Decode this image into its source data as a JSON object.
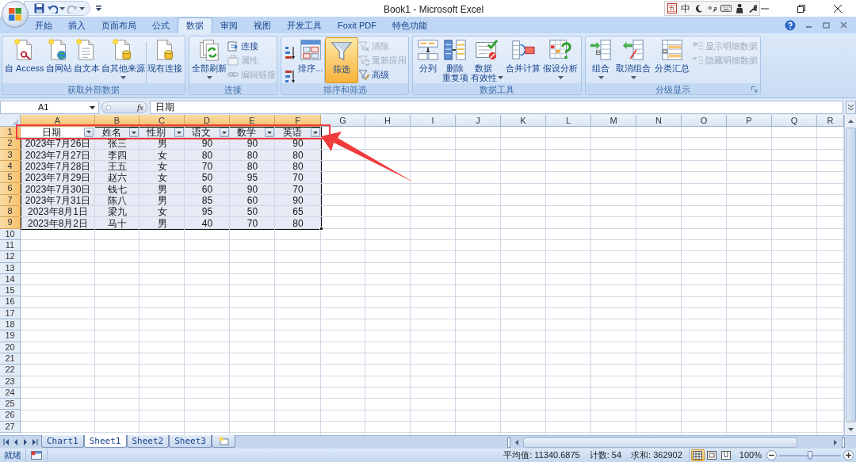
{
  "window": {
    "title": "Book1 - Microsoft Excel"
  },
  "ime_toolbar": {
    "items": [
      "五",
      "中"
    ]
  },
  "ribbon": {
    "tabs": [
      {
        "label": "开始",
        "selected": false
      },
      {
        "label": "插入",
        "selected": false
      },
      {
        "label": "页面布局",
        "selected": false
      },
      {
        "label": "公式",
        "selected": false
      },
      {
        "label": "数据",
        "selected": true
      },
      {
        "label": "审阅",
        "selected": false
      },
      {
        "label": "视图",
        "selected": false
      },
      {
        "label": "开发工具",
        "selected": false
      },
      {
        "label": "Foxit PDF",
        "selected": false
      },
      {
        "label": "特色功能",
        "selected": false
      }
    ],
    "groups": [
      {
        "label": "获取外部数据",
        "launcher": false,
        "items": [
          {
            "kind": "large",
            "label": "自 Access",
            "dropdown": false,
            "on": false
          },
          {
            "kind": "large",
            "label": "自网站",
            "dropdown": false,
            "on": false
          },
          {
            "kind": "large",
            "label": "自文本",
            "dropdown": false,
            "on": false
          },
          {
            "kind": "large",
            "label": "自其他来源",
            "dropdown": true,
            "on": false
          },
          {
            "kind": "separator"
          },
          {
            "kind": "large",
            "label": "现有连接",
            "dropdown": false,
            "on": false
          }
        ]
      },
      {
        "label": "连接",
        "launcher": false,
        "items": [
          {
            "kind": "large",
            "label": "全部刷新",
            "dropdown": true,
            "on": false
          },
          {
            "kind": "stack",
            "items": [
              {
                "label": "连接",
                "disabled": false
              },
              {
                "label": "属性",
                "disabled": true
              },
              {
                "label": "编辑链接",
                "disabled": true
              }
            ]
          }
        ]
      },
      {
        "label": "排序和筛选",
        "launcher": false,
        "items": [
          {
            "kind": "sort_pair"
          },
          {
            "kind": "large",
            "label": "排序...",
            "dropdown": false,
            "on": false
          },
          {
            "kind": "separator"
          },
          {
            "kind": "large",
            "label": "筛选",
            "dropdown": false,
            "on": true
          },
          {
            "kind": "stack",
            "items": [
              {
                "label": "清除",
                "disabled": true
              },
              {
                "label": "重新应用",
                "disabled": true
              },
              {
                "label": "高级",
                "disabled": false
              }
            ]
          }
        ]
      },
      {
        "label": "数据工具",
        "launcher": false,
        "items": [
          {
            "kind": "large",
            "label": "分列",
            "dropdown": false,
            "on": false
          },
          {
            "kind": "large",
            "lines": [
              "删除",
              "重复项"
            ],
            "dropdown": false,
            "on": false
          },
          {
            "kind": "large",
            "lines": [
              "数据",
              "有效性"
            ],
            "dropdown": true,
            "on": false
          },
          {
            "kind": "large",
            "label": "合并计算",
            "dropdown": false,
            "on": false
          },
          {
            "kind": "large",
            "label": "假设分析",
            "dropdown": true,
            "on": false
          }
        ]
      },
      {
        "label": "分级显示",
        "launcher": true,
        "items": [
          {
            "kind": "large",
            "label": "组合",
            "dropdown": true,
            "on": false
          },
          {
            "kind": "large",
            "label": "取消组合",
            "dropdown": true,
            "on": false
          },
          {
            "kind": "large",
            "label": "分类汇总",
            "dropdown": false,
            "on": false
          },
          {
            "kind": "stack",
            "items": [
              {
                "label": "显示明细数据",
                "disabled": true
              },
              {
                "label": "隐藏明细数据",
                "disabled": true
              }
            ]
          }
        ]
      }
    ]
  },
  "formula_bar": {
    "name_box": "A1",
    "fx_label": "fx",
    "content": "日期"
  },
  "sheet": {
    "columns": [
      {
        "label": "A",
        "selected": true
      },
      {
        "label": "B",
        "selected": true
      },
      {
        "label": "C",
        "selected": true
      },
      {
        "label": "D",
        "selected": true
      },
      {
        "label": "E",
        "selected": true
      },
      {
        "label": "F",
        "selected": true
      },
      {
        "label": "G",
        "selected": false
      },
      {
        "label": "H",
        "selected": false
      },
      {
        "label": "I",
        "selected": false
      },
      {
        "label": "J",
        "selected": false
      },
      {
        "label": "K",
        "selected": false
      },
      {
        "label": "L",
        "selected": false
      },
      {
        "label": "M",
        "selected": false
      },
      {
        "label": "N",
        "selected": false
      },
      {
        "label": "O",
        "selected": false
      },
      {
        "label": "P",
        "selected": false
      },
      {
        "label": "Q",
        "selected": false
      },
      {
        "label": "R",
        "selected": false
      }
    ],
    "row_headers": [
      {
        "label": "1",
        "selected": true
      },
      {
        "label": "2",
        "selected": true
      },
      {
        "label": "3",
        "selected": true
      },
      {
        "label": "4",
        "selected": true
      },
      {
        "label": "5",
        "selected": true
      },
      {
        "label": "6",
        "selected": true
      },
      {
        "label": "7",
        "selected": true
      },
      {
        "label": "8",
        "selected": true
      },
      {
        "label": "9",
        "selected": true
      },
      {
        "label": "10",
        "selected": false
      },
      {
        "label": "11",
        "selected": false
      },
      {
        "label": "12",
        "selected": false
      },
      {
        "label": "13",
        "selected": false
      },
      {
        "label": "14",
        "selected": false
      },
      {
        "label": "15",
        "selected": false
      },
      {
        "label": "16",
        "selected": false
      },
      {
        "label": "17",
        "selected": false
      },
      {
        "label": "18",
        "selected": false
      },
      {
        "label": "19",
        "selected": false
      },
      {
        "label": "20",
        "selected": false
      },
      {
        "label": "21",
        "selected": false
      },
      {
        "label": "22",
        "selected": false
      },
      {
        "label": "23",
        "selected": false
      },
      {
        "label": "24",
        "selected": false
      },
      {
        "label": "25",
        "selected": false
      },
      {
        "label": "26",
        "selected": false
      },
      {
        "label": "27",
        "selected": false
      }
    ],
    "table": {
      "autofilter": true,
      "header": [
        "日期",
        "姓名",
        "性别",
        "语文",
        "数学",
        "英语"
      ],
      "rows": [
        [
          "2023年7月26日",
          "张三",
          "男",
          "90",
          "90",
          "90"
        ],
        [
          "2023年7月27日",
          "李四",
          "女",
          "80",
          "80",
          "80"
        ],
        [
          "2023年7月28日",
          "王五",
          "女",
          "70",
          "80",
          "80"
        ],
        [
          "2023年7月29日",
          "赵六",
          "女",
          "50",
          "95",
          "70"
        ],
        [
          "2023年7月30日",
          "钱七",
          "男",
          "60",
          "90",
          "70"
        ],
        [
          "2023年7月31日",
          "陈八",
          "男",
          "85",
          "60",
          "90"
        ],
        [
          "2023年8月1日",
          "梁九",
          "女",
          "95",
          "50",
          "65"
        ],
        [
          "2023年8月2日",
          "马十",
          "男",
          "40",
          "70",
          "80"
        ]
      ]
    }
  },
  "sheet_tabs": [
    {
      "label": "Chart1",
      "selected": false
    },
    {
      "label": "Sheet1",
      "selected": true
    },
    {
      "label": "Sheet2",
      "selected": false
    },
    {
      "label": "Sheet3",
      "selected": false
    }
  ],
  "status_bar": {
    "state": "就绪",
    "stats": [
      "平均值: 11340.6875",
      "计数: 54",
      "求和: 362902"
    ],
    "views": [
      {
        "selected": true
      },
      {
        "selected": false
      },
      {
        "selected": false
      }
    ],
    "zoom": "100%",
    "zoom_slider": {
      "level": 0.5
    }
  }
}
